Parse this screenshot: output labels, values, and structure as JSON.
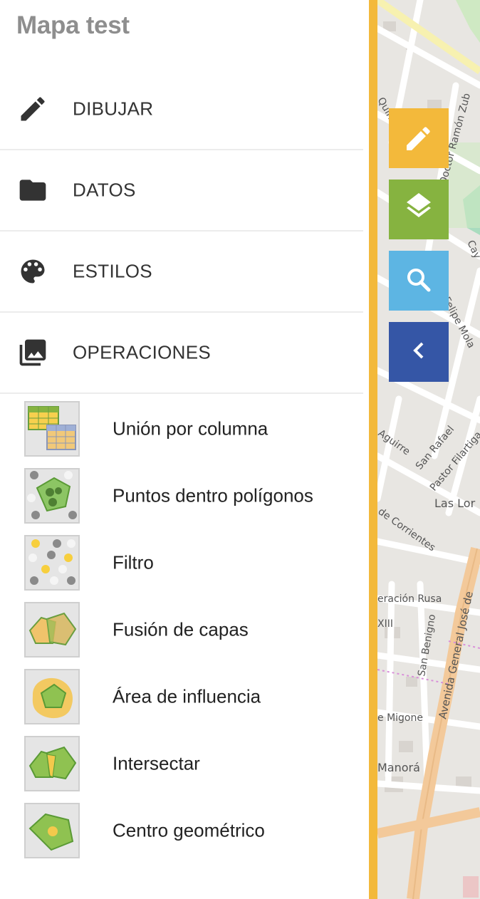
{
  "app": {
    "title": "Mapa test"
  },
  "menu": [
    {
      "label": "DIBUJAR",
      "icon": "pencil-icon"
    },
    {
      "label": "DATOS",
      "icon": "folder-icon"
    },
    {
      "label": "ESTILOS",
      "icon": "palette-icon"
    },
    {
      "label": "OPERACIONES",
      "icon": "photo-library-icon"
    }
  ],
  "operations": [
    {
      "label": "Unión por columna",
      "icon": "join-tables-icon"
    },
    {
      "label": "Puntos dentro polígonos",
      "icon": "points-in-polygons-icon"
    },
    {
      "label": "Filtro",
      "icon": "filter-points-icon"
    },
    {
      "label": "Fusión de capas",
      "icon": "merge-layers-icon"
    },
    {
      "label": "Área de influencia",
      "icon": "buffer-icon"
    },
    {
      "label": "Intersectar",
      "icon": "intersect-icon"
    },
    {
      "label": "Centro geométrico",
      "icon": "centroid-icon"
    }
  ],
  "toolbar": [
    {
      "name": "draw",
      "icon": "pencil-icon",
      "color": "#f3b93b"
    },
    {
      "name": "layers",
      "icon": "layers-icon",
      "color": "#86b340"
    },
    {
      "name": "search",
      "icon": "search-icon",
      "color": "#5db5e3"
    },
    {
      "name": "collapse",
      "icon": "chevron-left-icon",
      "color": "#3556a6"
    }
  ],
  "map": {
    "street_labels": [
      "Quin",
      "Doctor Ramón Zub",
      "Cay",
      "Felipe Mola",
      "Aguirre",
      "San Rafael",
      "Pastor Filartiga",
      "Las Lor",
      "de Corrientes",
      "eración Rusa",
      "XIII",
      "San Benigno",
      "Avenida General José de",
      "e Migone",
      "Manorá"
    ]
  },
  "colors": {
    "accent_border": "#f3b93b",
    "title": "#8e8e8e"
  }
}
